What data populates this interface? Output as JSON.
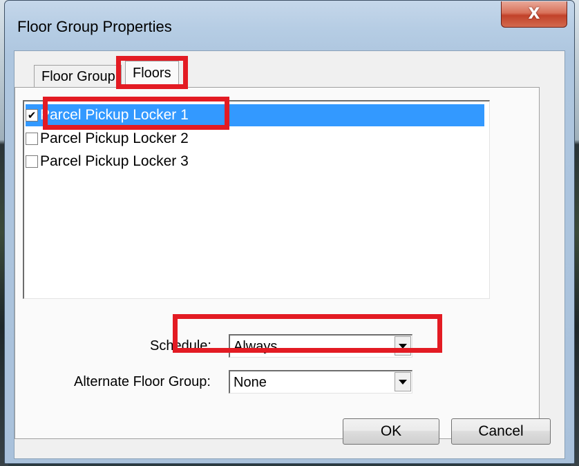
{
  "window": {
    "title": "Floor Group Properties",
    "close_glyph": "X"
  },
  "tabs": [
    {
      "label": "Floor Group",
      "active": false
    },
    {
      "label": "Floors",
      "active": true
    }
  ],
  "floors_list": [
    {
      "label": "Parcel Pickup Locker 1",
      "checked": true,
      "selected": true
    },
    {
      "label": "Parcel Pickup Locker 2",
      "checked": false,
      "selected": false
    },
    {
      "label": "Parcel Pickup Locker 3",
      "checked": false,
      "selected": false
    }
  ],
  "schedule": {
    "label": "Schedule:",
    "value": "Always"
  },
  "alternate_floor_group": {
    "label": "Alternate Floor Group:",
    "value": "None"
  },
  "buttons": {
    "ok": "OK",
    "cancel": "Cancel"
  },
  "check_glyph": "✔",
  "colors": {
    "highlight": "#e31b23",
    "selection": "#3399ff"
  }
}
